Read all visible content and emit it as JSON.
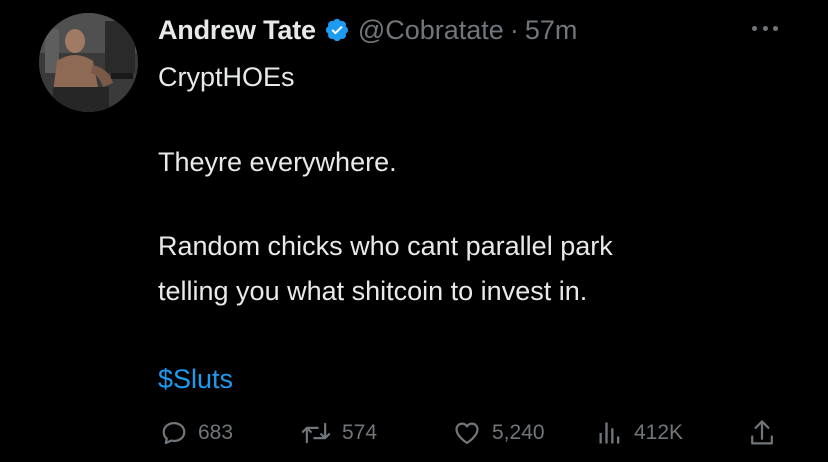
{
  "tweet": {
    "display_name": "Andrew Tate",
    "handle": "@Cobratate",
    "separator": "·",
    "time": "57m",
    "lines": [
      "CryptHOEs",
      "Theyre everywhere.",
      "Random chicks who cant parallel park",
      "telling you what shitcoin to invest in."
    ],
    "hashtag": "$Sluts"
  },
  "actions": {
    "replies": "683",
    "retweets": "574",
    "likes": "5,240",
    "views": "412K"
  },
  "colors": {
    "background": "#000000",
    "text": "#e7e9ea",
    "secondary": "#71767b",
    "accent": "#1d9bf0"
  },
  "icons": {
    "verified": "verified-badge-icon",
    "more": "more-options-icon",
    "reply": "reply-icon",
    "retweet": "retweet-icon",
    "like": "heart-icon",
    "views": "views-icon",
    "share": "share-icon"
  }
}
